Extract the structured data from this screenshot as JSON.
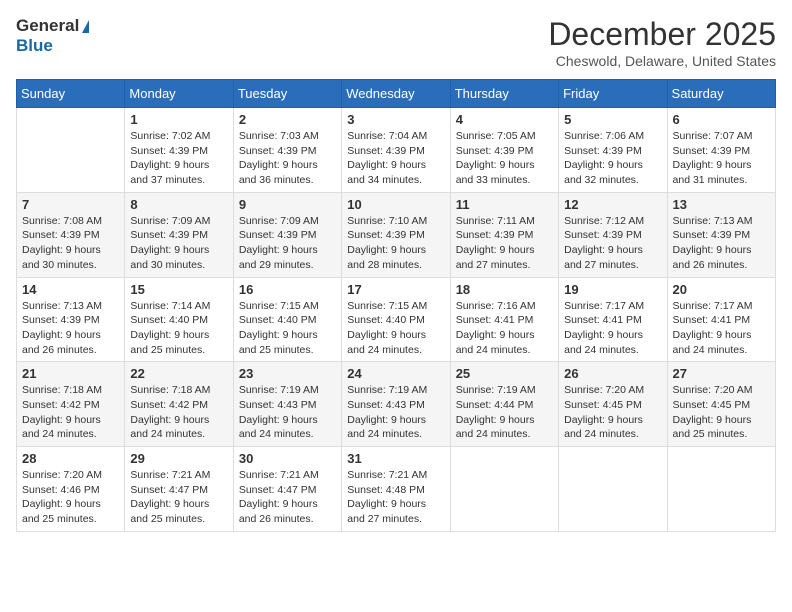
{
  "header": {
    "logo_general": "General",
    "logo_blue": "Blue",
    "month_title": "December 2025",
    "location": "Cheswold, Delaware, United States"
  },
  "days_of_week": [
    "Sunday",
    "Monday",
    "Tuesday",
    "Wednesday",
    "Thursday",
    "Friday",
    "Saturday"
  ],
  "weeks": [
    [
      {
        "day": "",
        "sunrise": "",
        "sunset": "",
        "daylight": ""
      },
      {
        "day": "1",
        "sunrise": "Sunrise: 7:02 AM",
        "sunset": "Sunset: 4:39 PM",
        "daylight": "Daylight: 9 hours and 37 minutes."
      },
      {
        "day": "2",
        "sunrise": "Sunrise: 7:03 AM",
        "sunset": "Sunset: 4:39 PM",
        "daylight": "Daylight: 9 hours and 36 minutes."
      },
      {
        "day": "3",
        "sunrise": "Sunrise: 7:04 AM",
        "sunset": "Sunset: 4:39 PM",
        "daylight": "Daylight: 9 hours and 34 minutes."
      },
      {
        "day": "4",
        "sunrise": "Sunrise: 7:05 AM",
        "sunset": "Sunset: 4:39 PM",
        "daylight": "Daylight: 9 hours and 33 minutes."
      },
      {
        "day": "5",
        "sunrise": "Sunrise: 7:06 AM",
        "sunset": "Sunset: 4:39 PM",
        "daylight": "Daylight: 9 hours and 32 minutes."
      },
      {
        "day": "6",
        "sunrise": "Sunrise: 7:07 AM",
        "sunset": "Sunset: 4:39 PM",
        "daylight": "Daylight: 9 hours and 31 minutes."
      }
    ],
    [
      {
        "day": "7",
        "sunrise": "Sunrise: 7:08 AM",
        "sunset": "Sunset: 4:39 PM",
        "daylight": "Daylight: 9 hours and 30 minutes."
      },
      {
        "day": "8",
        "sunrise": "Sunrise: 7:09 AM",
        "sunset": "Sunset: 4:39 PM",
        "daylight": "Daylight: 9 hours and 30 minutes."
      },
      {
        "day": "9",
        "sunrise": "Sunrise: 7:09 AM",
        "sunset": "Sunset: 4:39 PM",
        "daylight": "Daylight: 9 hours and 29 minutes."
      },
      {
        "day": "10",
        "sunrise": "Sunrise: 7:10 AM",
        "sunset": "Sunset: 4:39 PM",
        "daylight": "Daylight: 9 hours and 28 minutes."
      },
      {
        "day": "11",
        "sunrise": "Sunrise: 7:11 AM",
        "sunset": "Sunset: 4:39 PM",
        "daylight": "Daylight: 9 hours and 27 minutes."
      },
      {
        "day": "12",
        "sunrise": "Sunrise: 7:12 AM",
        "sunset": "Sunset: 4:39 PM",
        "daylight": "Daylight: 9 hours and 27 minutes."
      },
      {
        "day": "13",
        "sunrise": "Sunrise: 7:13 AM",
        "sunset": "Sunset: 4:39 PM",
        "daylight": "Daylight: 9 hours and 26 minutes."
      }
    ],
    [
      {
        "day": "14",
        "sunrise": "Sunrise: 7:13 AM",
        "sunset": "Sunset: 4:39 PM",
        "daylight": "Daylight: 9 hours and 26 minutes."
      },
      {
        "day": "15",
        "sunrise": "Sunrise: 7:14 AM",
        "sunset": "Sunset: 4:40 PM",
        "daylight": "Daylight: 9 hours and 25 minutes."
      },
      {
        "day": "16",
        "sunrise": "Sunrise: 7:15 AM",
        "sunset": "Sunset: 4:40 PM",
        "daylight": "Daylight: 9 hours and 25 minutes."
      },
      {
        "day": "17",
        "sunrise": "Sunrise: 7:15 AM",
        "sunset": "Sunset: 4:40 PM",
        "daylight": "Daylight: 9 hours and 24 minutes."
      },
      {
        "day": "18",
        "sunrise": "Sunrise: 7:16 AM",
        "sunset": "Sunset: 4:41 PM",
        "daylight": "Daylight: 9 hours and 24 minutes."
      },
      {
        "day": "19",
        "sunrise": "Sunrise: 7:17 AM",
        "sunset": "Sunset: 4:41 PM",
        "daylight": "Daylight: 9 hours and 24 minutes."
      },
      {
        "day": "20",
        "sunrise": "Sunrise: 7:17 AM",
        "sunset": "Sunset: 4:41 PM",
        "daylight": "Daylight: 9 hours and 24 minutes."
      }
    ],
    [
      {
        "day": "21",
        "sunrise": "Sunrise: 7:18 AM",
        "sunset": "Sunset: 4:42 PM",
        "daylight": "Daylight: 9 hours and 24 minutes."
      },
      {
        "day": "22",
        "sunrise": "Sunrise: 7:18 AM",
        "sunset": "Sunset: 4:42 PM",
        "daylight": "Daylight: 9 hours and 24 minutes."
      },
      {
        "day": "23",
        "sunrise": "Sunrise: 7:19 AM",
        "sunset": "Sunset: 4:43 PM",
        "daylight": "Daylight: 9 hours and 24 minutes."
      },
      {
        "day": "24",
        "sunrise": "Sunrise: 7:19 AM",
        "sunset": "Sunset: 4:43 PM",
        "daylight": "Daylight: 9 hours and 24 minutes."
      },
      {
        "day": "25",
        "sunrise": "Sunrise: 7:19 AM",
        "sunset": "Sunset: 4:44 PM",
        "daylight": "Daylight: 9 hours and 24 minutes."
      },
      {
        "day": "26",
        "sunrise": "Sunrise: 7:20 AM",
        "sunset": "Sunset: 4:45 PM",
        "daylight": "Daylight: 9 hours and 24 minutes."
      },
      {
        "day": "27",
        "sunrise": "Sunrise: 7:20 AM",
        "sunset": "Sunset: 4:45 PM",
        "daylight": "Daylight: 9 hours and 25 minutes."
      }
    ],
    [
      {
        "day": "28",
        "sunrise": "Sunrise: 7:20 AM",
        "sunset": "Sunset: 4:46 PM",
        "daylight": "Daylight: 9 hours and 25 minutes."
      },
      {
        "day": "29",
        "sunrise": "Sunrise: 7:21 AM",
        "sunset": "Sunset: 4:47 PM",
        "daylight": "Daylight: 9 hours and 25 minutes."
      },
      {
        "day": "30",
        "sunrise": "Sunrise: 7:21 AM",
        "sunset": "Sunset: 4:47 PM",
        "daylight": "Daylight: 9 hours and 26 minutes."
      },
      {
        "day": "31",
        "sunrise": "Sunrise: 7:21 AM",
        "sunset": "Sunset: 4:48 PM",
        "daylight": "Daylight: 9 hours and 27 minutes."
      },
      {
        "day": "",
        "sunrise": "",
        "sunset": "",
        "daylight": ""
      },
      {
        "day": "",
        "sunrise": "",
        "sunset": "",
        "daylight": ""
      },
      {
        "day": "",
        "sunrise": "",
        "sunset": "",
        "daylight": ""
      }
    ]
  ]
}
